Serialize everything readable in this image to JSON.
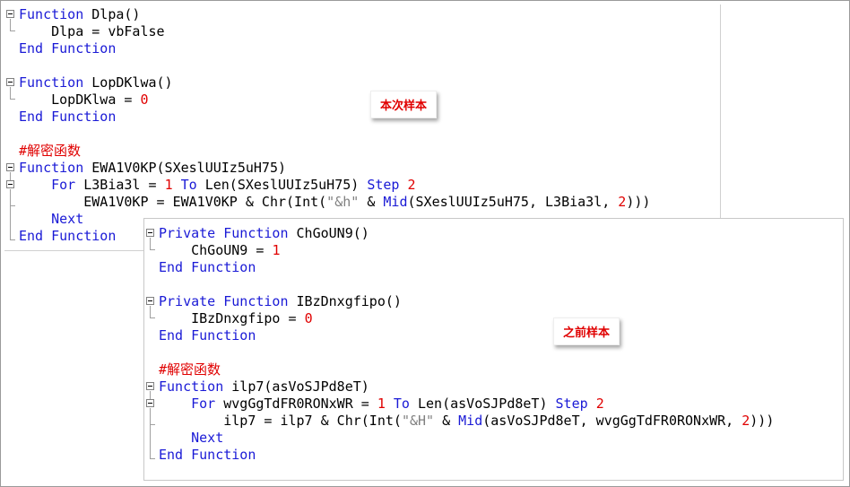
{
  "labels": {
    "current_sample": "本次样本",
    "previous_sample": "之前样本"
  },
  "panel1": {
    "lines": [
      [
        {
          "t": "Function",
          "c": "kw"
        },
        {
          "t": " Dlpa()"
        }
      ],
      [
        {
          "t": "    Dlpa = vbFalse"
        }
      ],
      [
        {
          "t": "End Function",
          "c": "kw"
        }
      ],
      [],
      [
        {
          "t": "Function",
          "c": "kw"
        },
        {
          "t": " LopDKlwa()"
        }
      ],
      [
        {
          "t": "    LopDKlwa = "
        },
        {
          "t": "0",
          "c": "red"
        }
      ],
      [
        {
          "t": "End Function",
          "c": "kw"
        }
      ],
      [],
      [
        {
          "t": "#解密函数",
          "c": "red"
        }
      ],
      [
        {
          "t": "Function",
          "c": "kw"
        },
        {
          "t": " EWA1V0KP(SXeslUUIz5uH75)"
        }
      ],
      [
        {
          "t": "    "
        },
        {
          "t": "For",
          "c": "kw"
        },
        {
          "t": " L3Bia3l = "
        },
        {
          "t": "1",
          "c": "red"
        },
        {
          "t": " "
        },
        {
          "t": "To",
          "c": "kw"
        },
        {
          "t": " Len(SXeslUUIz5uH75) "
        },
        {
          "t": "Step",
          "c": "kw"
        },
        {
          "t": " "
        },
        {
          "t": "2",
          "c": "red"
        }
      ],
      [
        {
          "t": "        EWA1V0KP = EWA1V0KP & Chr(Int("
        },
        {
          "t": "\"&h\"",
          "c": "str"
        },
        {
          "t": " & "
        },
        {
          "t": "Mid",
          "c": "kw"
        },
        {
          "t": "(SXeslUUIz5uH75, L3Bia3l, "
        },
        {
          "t": "2",
          "c": "red"
        },
        {
          "t": ")))"
        }
      ],
      [
        {
          "t": "    "
        },
        {
          "t": "Next",
          "c": "kw"
        }
      ],
      [
        {
          "t": "End Function",
          "c": "kw"
        }
      ]
    ]
  },
  "panel2": {
    "lines": [
      [
        {
          "t": "Private Function",
          "c": "kw"
        },
        {
          "t": " ChGoUN9()"
        }
      ],
      [
        {
          "t": "    ChGoUN9 = "
        },
        {
          "t": "1",
          "c": "red"
        }
      ],
      [
        {
          "t": "End Function",
          "c": "kw"
        }
      ],
      [],
      [
        {
          "t": "Private Function",
          "c": "kw"
        },
        {
          "t": " IBzDnxgfipo()"
        }
      ],
      [
        {
          "t": "    IBzDnxgfipo = "
        },
        {
          "t": "0",
          "c": "red"
        }
      ],
      [
        {
          "t": "End Function",
          "c": "kw"
        }
      ],
      [],
      [
        {
          "t": "#解密函数",
          "c": "red"
        }
      ],
      [
        {
          "t": "Function",
          "c": "kw"
        },
        {
          "t": " ilp7(asVoSJPd8eT)"
        }
      ],
      [
        {
          "t": "    "
        },
        {
          "t": "For",
          "c": "kw"
        },
        {
          "t": " wvgGgTdFR0RONxWR = "
        },
        {
          "t": "1",
          "c": "red"
        },
        {
          "t": " "
        },
        {
          "t": "To",
          "c": "kw"
        },
        {
          "t": " Len(asVoSJPd8eT) "
        },
        {
          "t": "Step",
          "c": "kw"
        },
        {
          "t": " "
        },
        {
          "t": "2",
          "c": "red"
        }
      ],
      [
        {
          "t": "        ilp7 = ilp7 & Chr(Int("
        },
        {
          "t": "\"&H\"",
          "c": "str"
        },
        {
          "t": " & "
        },
        {
          "t": "Mid",
          "c": "kw"
        },
        {
          "t": "(asVoSJPd8eT, wvgGgTdFR0RONxWR, "
        },
        {
          "t": "2",
          "c": "red"
        },
        {
          "t": ")))"
        }
      ],
      [
        {
          "t": "    "
        },
        {
          "t": "Next",
          "c": "kw"
        }
      ],
      [
        {
          "t": "End Function",
          "c": "kw"
        }
      ]
    ]
  },
  "colors": {
    "keyword": "#1a1ad6",
    "number": "#e00000",
    "string": "#808080",
    "label_text": "#e00000"
  }
}
